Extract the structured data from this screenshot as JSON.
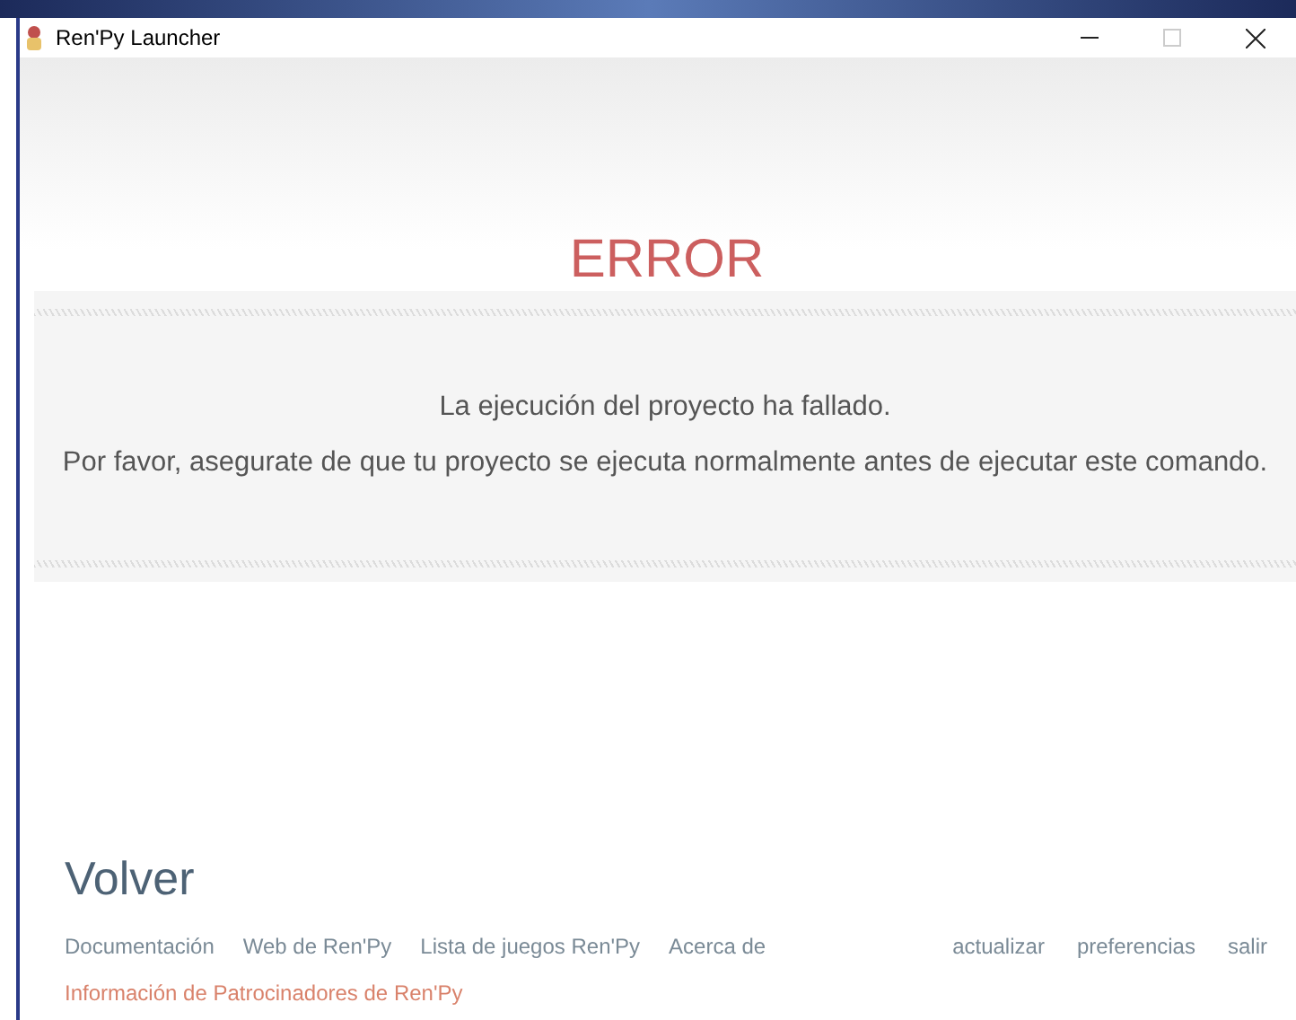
{
  "window": {
    "title": "Ren'Py Launcher"
  },
  "error": {
    "title": "ERROR",
    "lines": [
      "La ejecución del proyecto ha fallado.",
      "Por favor, asegurate de que tu proyecto se ejecuta normalmente antes de ejecutar este comando."
    ]
  },
  "back_button": "Volver",
  "footer": {
    "links": [
      {
        "label": "Documentación",
        "kind": "left"
      },
      {
        "label": "Web de Ren'Py",
        "kind": "left"
      },
      {
        "label": "Lista de juegos Ren'Py",
        "kind": "left"
      },
      {
        "label": "Acerca de",
        "kind": "left"
      },
      {
        "label": "actualizar",
        "kind": "right"
      },
      {
        "label": "preferencias",
        "kind": "right"
      },
      {
        "label": "salir",
        "kind": "right"
      },
      {
        "label": "Información de Patrocinadores de Ren'Py",
        "kind": "sponsor"
      }
    ]
  }
}
